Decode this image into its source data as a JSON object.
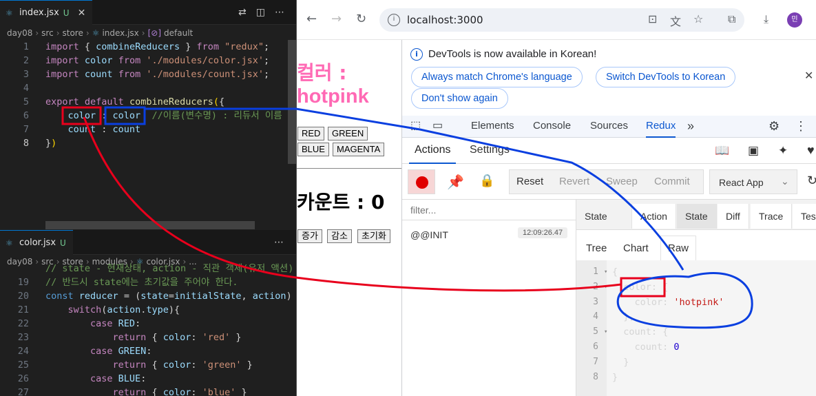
{
  "editor1": {
    "tab": {
      "name": "index.jsx",
      "badge": "U"
    },
    "breadcrumb": [
      "day08",
      "src",
      "store",
      "index.jsx",
      "default"
    ],
    "lines": [
      {
        "n": "1",
        "parts": [
          [
            "k",
            "import "
          ],
          [
            "p",
            "{ "
          ],
          [
            "v",
            "combineReducers"
          ],
          [
            "p",
            " } "
          ],
          [
            "k",
            "from "
          ],
          [
            "s",
            "\"redux\""
          ],
          [
            "p",
            ";"
          ]
        ]
      },
      {
        "n": "2",
        "parts": [
          [
            "k",
            "import "
          ],
          [
            "v",
            "color "
          ],
          [
            "k",
            "from "
          ],
          [
            "s",
            "'./modules/color.jsx'"
          ],
          [
            "p",
            ";"
          ]
        ]
      },
      {
        "n": "3",
        "parts": [
          [
            "k",
            "import "
          ],
          [
            "v",
            "count "
          ],
          [
            "k",
            "from "
          ],
          [
            "s",
            "'./modules/count.jsx'"
          ],
          [
            "p",
            ";"
          ]
        ]
      },
      {
        "n": "4",
        "parts": []
      },
      {
        "n": "5",
        "parts": [
          [
            "k",
            "export "
          ],
          [
            "k",
            "default "
          ],
          [
            "f",
            "combineReducers"
          ],
          [
            "br",
            "("
          ],
          [
            "p",
            "{"
          ]
        ]
      },
      {
        "n": "6",
        "parts": [
          [
            "p",
            "    "
          ],
          [
            "v",
            "color"
          ],
          [
            "p",
            " : "
          ],
          [
            "v",
            "color"
          ],
          [
            "p",
            "  "
          ],
          [
            "c",
            "//이름(변수명) : 리듀서 이름"
          ]
        ]
      },
      {
        "n": "7",
        "parts": [
          [
            "p",
            "    "
          ],
          [
            "v",
            "count"
          ],
          [
            "p",
            " : "
          ],
          [
            "v",
            "count"
          ]
        ]
      },
      {
        "n": "8",
        "parts": [
          [
            "p",
            "}"
          ],
          [
            "br",
            ")"
          ]
        ]
      }
    ]
  },
  "editor2": {
    "tab": {
      "name": "color.jsx",
      "badge": "U"
    },
    "breadcrumb": [
      "day08",
      "src",
      "store",
      "modules",
      "color.jsx",
      "..."
    ],
    "lines": [
      {
        "n": "",
        "parts": [
          [
            "c",
            "// state - 현재상태, action - 직관 객체(유저 액션)"
          ]
        ]
      },
      {
        "n": "19",
        "parts": [
          [
            "c",
            "// 반드시 state에는 초기값을 주어야 한다."
          ]
        ]
      },
      {
        "n": "20",
        "parts": [
          [
            "kb",
            "const "
          ],
          [
            "v",
            "reducer"
          ],
          [
            "p",
            " = ("
          ],
          [
            "v",
            "state"
          ],
          [
            "p",
            "="
          ],
          [
            "v",
            "initialState"
          ],
          [
            "p",
            ", "
          ],
          [
            "v",
            "action"
          ],
          [
            "p",
            ")"
          ]
        ]
      },
      {
        "n": "21",
        "parts": [
          [
            "p",
            "    "
          ],
          [
            "k",
            "switch"
          ],
          [
            "p",
            "("
          ],
          [
            "v",
            "action"
          ],
          [
            "p",
            "."
          ],
          [
            "v",
            "type"
          ],
          [
            "p",
            "){"
          ]
        ]
      },
      {
        "n": "22",
        "parts": [
          [
            "p",
            "        "
          ],
          [
            "k",
            "case "
          ],
          [
            "v",
            "RED"
          ],
          [
            "p",
            ":"
          ]
        ]
      },
      {
        "n": "23",
        "parts": [
          [
            "p",
            "            "
          ],
          [
            "k",
            "return "
          ],
          [
            "p",
            "{ "
          ],
          [
            "v",
            "color"
          ],
          [
            "p",
            ": "
          ],
          [
            "s",
            "'red'"
          ],
          [
            "p",
            " }"
          ]
        ]
      },
      {
        "n": "24",
        "parts": [
          [
            "p",
            "        "
          ],
          [
            "k",
            "case "
          ],
          [
            "v",
            "GREEN"
          ],
          [
            "p",
            ":"
          ]
        ]
      },
      {
        "n": "25",
        "parts": [
          [
            "p",
            "            "
          ],
          [
            "k",
            "return "
          ],
          [
            "p",
            "{ "
          ],
          [
            "v",
            "color"
          ],
          [
            "p",
            ": "
          ],
          [
            "s",
            "'green'"
          ],
          [
            "p",
            " }"
          ]
        ]
      },
      {
        "n": "26",
        "parts": [
          [
            "p",
            "        "
          ],
          [
            "k",
            "case "
          ],
          [
            "v",
            "BLUE"
          ],
          [
            "p",
            ":"
          ]
        ]
      },
      {
        "n": "27",
        "parts": [
          [
            "p",
            "            "
          ],
          [
            "k",
            "return "
          ],
          [
            "p",
            "{ "
          ],
          [
            "v",
            "color"
          ],
          [
            "p",
            ": "
          ],
          [
            "s",
            "'blue'"
          ],
          [
            "p",
            " }"
          ]
        ]
      }
    ]
  },
  "browser": {
    "url": "localhost:3000",
    "avatar": "민",
    "page": {
      "color_title_line1": "컬러 :",
      "color_title_line2": "hotpink",
      "color_buttons": [
        "RED",
        "GREEN",
        "BLUE",
        "MAGENTA"
      ],
      "count_title": "카운트 : 0",
      "count_buttons": [
        "증가",
        "감소",
        "초기화"
      ]
    },
    "devtools": {
      "banner": "DevTools is now available in Korean!",
      "banner_buttons": [
        "Always match Chrome's language",
        "Switch DevTools to Korean",
        "Don't show again"
      ],
      "tabs": [
        "Elements",
        "Console",
        "Sources",
        "Redux"
      ],
      "active_tab": "Redux",
      "redux_tabs": [
        "Actions",
        "Settings"
      ],
      "toolbar": [
        "Reset",
        "Revert",
        "Sweep",
        "Commit"
      ],
      "instance": "React App",
      "filter_placeholder": "filter...",
      "action": {
        "name": "@@INIT",
        "time": "12:09:26.47"
      },
      "monitor_tabs": [
        "State",
        "Action",
        "State",
        "Diff",
        "Trace",
        "Test"
      ],
      "view_tabs": [
        "Tree",
        "Chart",
        "Raw"
      ],
      "raw_lines": [
        {
          "n": "1",
          "fold": true,
          "parts": [
            [
              "p",
              "{"
            ]
          ]
        },
        {
          "n": "2",
          "fold": true,
          "parts": [
            [
              "p",
              "  color: {"
            ]
          ]
        },
        {
          "n": "3",
          "fold": false,
          "parts": [
            [
              "p",
              "    color: "
            ],
            [
              "str",
              "'hotpink'"
            ]
          ]
        },
        {
          "n": "4",
          "fold": false,
          "parts": [
            [
              "p",
              "  },"
            ]
          ]
        },
        {
          "n": "5",
          "fold": true,
          "parts": [
            [
              "p",
              "  count: {"
            ]
          ]
        },
        {
          "n": "6",
          "fold": false,
          "parts": [
            [
              "p",
              "    count: "
            ],
            [
              "num",
              "0"
            ]
          ]
        },
        {
          "n": "7",
          "fold": false,
          "parts": [
            [
              "p",
              "  }"
            ]
          ]
        },
        {
          "n": "8",
          "fold": false,
          "parts": [
            [
              "p",
              "}"
            ]
          ]
        }
      ]
    }
  },
  "colors": {
    "accent_red": "#e8001c",
    "accent_blue": "#0a3fe0",
    "hotpink": "#ff69b4",
    "redux_purple": "#7a3fb3"
  }
}
